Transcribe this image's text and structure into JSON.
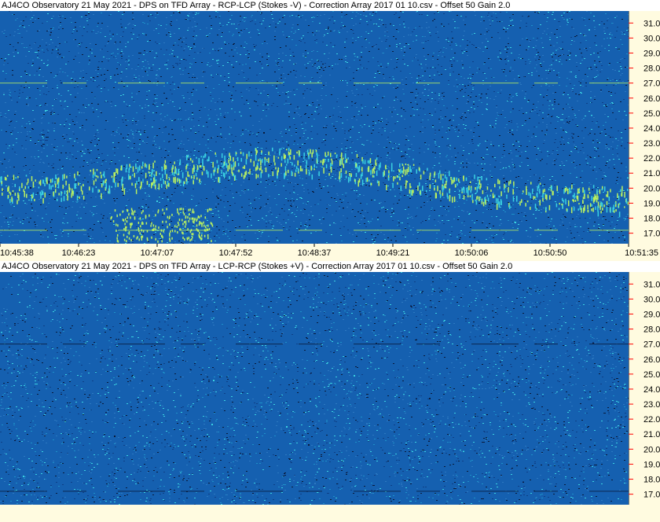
{
  "panels": [
    {
      "title": "AJ4CO Observatory 21 May 2021  -  DPS on TFD Array  -  RCP-LCP (Stokes -V)  -  Correction Array 2017 01 10.csv  -  Offset 50  Gain 2.0"
    },
    {
      "title": "AJ4CO Observatory 21 May 2021  -  DPS on TFD Array  -  LCP-RCP (Stokes +V)  -  Correction Array 2017 01 10.csv  -  Offset 50  Gain 2.0"
    }
  ],
  "colors": {
    "background": "#fffbe0",
    "spectrogram_base": "#1560b0",
    "spectrogram_dark": "#0a1a3a",
    "spectrogram_mid": "#1e90c8",
    "spectrogram_bright": "#3ad0e0",
    "signal_highlight": "#b8f060",
    "tick_red": "#ff0000"
  },
  "chart_data": [
    {
      "type": "heatmap",
      "title": "AJ4CO Observatory 21 May 2021  -  DPS on TFD Array  -  RCP-LCP (Stokes -V)  -  Correction Array 2017 01 10.csv  -  Offset 50  Gain 2.0",
      "x_ticks": [
        "10:45:38",
        "10:46:23",
        "10:47:07",
        "10:47:52",
        "10:48:37",
        "10:49:21",
        "10:50:06",
        "10:50:50",
        "10:51:35"
      ],
      "y_ticks": [
        "31.0",
        "30.0",
        "29.0",
        "28.0",
        "27.0",
        "26.0",
        "25.0",
        "24.0",
        "23.0",
        "22.0",
        "21.0",
        "20.0",
        "19.0",
        "18.0",
        "17.0"
      ],
      "ylim": [
        16.3,
        31.8
      ],
      "xlim": [
        "10:45:38",
        "10:51:35"
      ],
      "features": [
        {
          "label": "emission arc",
          "t_start": "10:45:38",
          "t_end": "10:51:35",
          "f_range": [
            18.0,
            22.5
          ]
        }
      ]
    },
    {
      "type": "heatmap",
      "title": "AJ4CO Observatory 21 May 2021  -  DPS on TFD Array  -  LCP-RCP (Stokes +V)  -  Correction Array 2017 01 10.csv  -  Offset 50  Gain 2.0",
      "x_ticks": [],
      "y_ticks": [
        "31.0",
        "30.0",
        "29.0",
        "28.0",
        "27.0",
        "26.0",
        "25.0",
        "24.0",
        "23.0",
        "22.0",
        "21.0",
        "20.0",
        "19.0",
        "18.0",
        "17.0"
      ],
      "ylim": [
        16.3,
        31.8
      ]
    }
  ]
}
